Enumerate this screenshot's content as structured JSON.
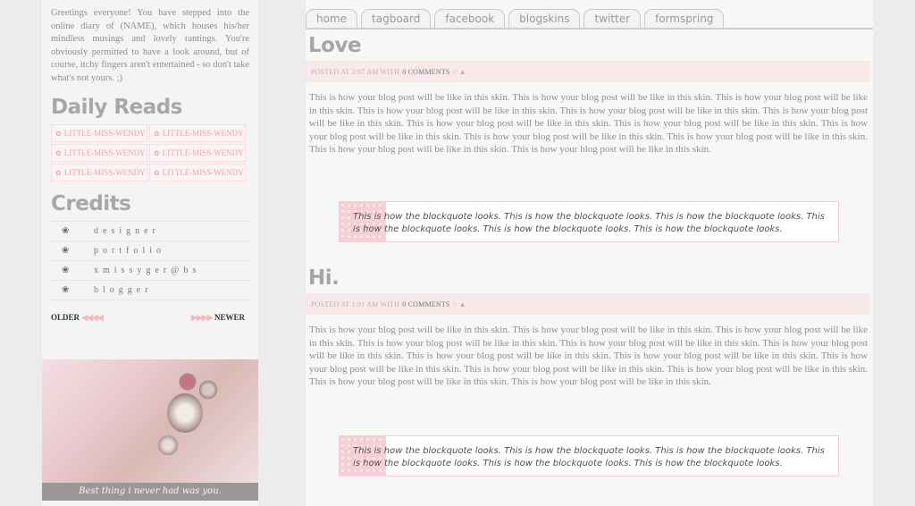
{
  "sidebar": {
    "intro": "Greetings everyone! You have stepped into the online diary of (NAME), which houses his/her mindless musings and lovely rantings. You're obviously permitted to have a look around, but of course, itchy fingers aren't entertained - so don't take what's not yours. ;)",
    "daily_reads_heading": "Daily Reads",
    "daily_reads": [
      "LITTLE-MISS-WENDY",
      "LITTLE-MISS-WENDY",
      "LITTLE-MISS-WENDY",
      "LITTLE-MISS-WENDY",
      "LITTLE-MISS-WENDY",
      "LITTLE-MISS-WENDY"
    ],
    "credits_heading": "Credits",
    "credits": [
      "designer",
      "portfolio",
      "xmissyger@bs",
      "blogger"
    ],
    "older_label": "OLDER",
    "newer_label": "NEWER",
    "photo_caption": "Best thing i never had was you."
  },
  "tabs": [
    "home",
    "tagboard",
    "facebook",
    "blogskins",
    "twitter",
    "formspring"
  ],
  "posts": [
    {
      "title": "Love",
      "meta_prefix": "POSTED AT 3:07 AM WITH",
      "comments": "0 COMMENTS",
      "meta_suffix": "// ▲",
      "body": "This is how your blog post will be like in this skin. This is how your blog post will be like in this skin. This is how your blog post will be like in this skin. This is how your blog post will be like in this skin. This is how your blog post will be like in this skin. This is how your blog post will be like in this skin. This is how your blog post will be like in this skin. This is how your blog post will be like in this skin. This is how your blog post will be like in this skin. This is how your blog post will be like in this skin. This is how your blog post will be like in this skin. This is how your blog post will be like in this skin. This is how your blog post will be like in this skin.",
      "quote": "This is how the blockquote looks. This is how the blockquote looks. This is how the blockquote looks. This is how the blockquote looks. This is how the blockquote looks. This is how the blockquote looks."
    },
    {
      "title": "Hi.",
      "meta_prefix": "POSTED AT 1:01 AM WITH",
      "comments": "0 COMMENTS",
      "meta_suffix": "// ▲",
      "body": "This is how your blog post will be like in this skin. This is how your blog post will be like in this skin. This is how your blog post will be like in this skin. This is how your blog post will be like in this skin. This is how your blog post will be like in this skin. This is how your blog post will be like in this skin. This is how your blog post will be like in this skin. This is how your blog post will be like in this skin. This is how your blog post will be like in this skin. This is how your blog post will be like in this skin. This is how your blog post will be like in this skin. This is how your blog post will be like in this skin. This is how your blog post will be like in this skin.",
      "quote": "This is how the blockquote looks. This is how the blockquote looks. This is how the blockquote looks. This is how the blockquote looks. This is how the blockquote looks. This is how the blockquote looks."
    }
  ]
}
